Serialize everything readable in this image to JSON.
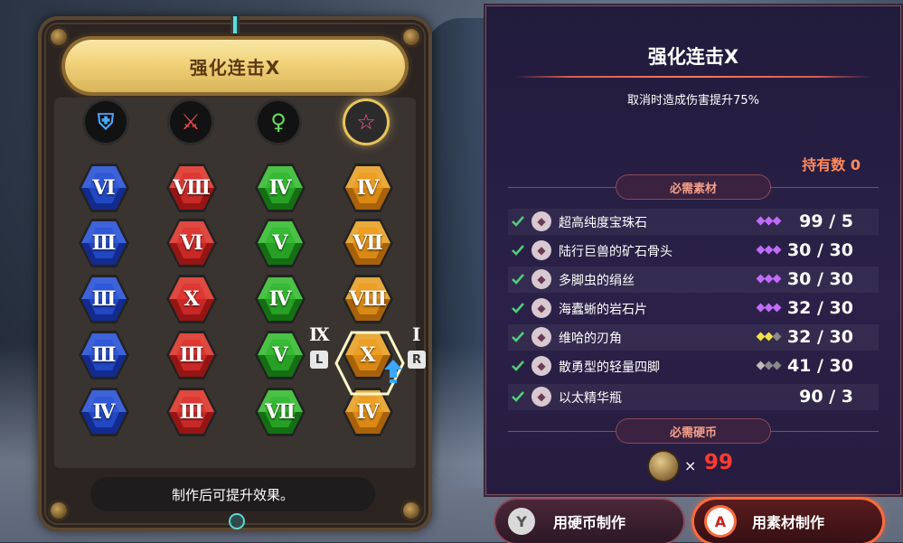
{
  "left_panel": {
    "title": "强化连击X",
    "hint": "制作后可提升效果。",
    "categories": [
      {
        "icon": "shield-icon",
        "glyph": "⛨",
        "color": "#4aa8ff"
      },
      {
        "icon": "sword-icon",
        "glyph": "⚔",
        "color": "#ff4a55"
      },
      {
        "icon": "vitality-icon",
        "glyph": "♀",
        "color": "#62e25a"
      },
      {
        "icon": "star-icon",
        "glyph": "☆",
        "color": "#ff5a8a"
      }
    ],
    "gem_grid": [
      [
        "Ⅵ",
        "Ⅷ",
        "Ⅳ",
        "Ⅳ"
      ],
      [
        "Ⅲ",
        "Ⅵ",
        "Ⅴ",
        "Ⅶ"
      ],
      [
        "Ⅲ",
        "Ⅹ",
        "Ⅳ",
        "Ⅷ"
      ],
      [
        "Ⅲ",
        "Ⅲ",
        "Ⅴ",
        "Ⅹ"
      ],
      [
        "Ⅳ",
        "Ⅲ",
        "Ⅶ",
        "Ⅳ"
      ]
    ],
    "gem_colors": [
      "#2a54d8",
      "#e0322e",
      "#2fb52d",
      "#f09a1a"
    ],
    "prev_level": "Ⅸ",
    "next_level": "Ⅰ",
    "prev_key": "L",
    "next_key": "R"
  },
  "detail": {
    "title": "强化连击X",
    "description": "取消时造成伤害提升75%",
    "owned_label": "持有数",
    "owned_value": "0",
    "materials_header": "必需素材",
    "materials": [
      {
        "name": "超高纯度宝珠石",
        "count": "99 / 5",
        "rarity": [
          "#c26bff",
          "#c26bff",
          "#c26bff"
        ],
        "icon": "orb-icon"
      },
      {
        "name": "陆行巨兽的矿石骨头",
        "count": "30 / 30",
        "rarity": [
          "#c26bff",
          "#c26bff",
          "#c26bff"
        ],
        "icon": "bone-icon"
      },
      {
        "name": "多脚虫的绢丝",
        "count": "30 / 30",
        "rarity": [
          "#c26bff",
          "#c26bff",
          "#c26bff"
        ],
        "icon": "silk-icon"
      },
      {
        "name": "海蠹蜥的岩石片",
        "count": "32 / 30",
        "rarity": [
          "#c26bff",
          "#c26bff",
          "#c26bff"
        ],
        "icon": "rock-shard-icon"
      },
      {
        "name": "维哈的刃角",
        "count": "32 / 30",
        "rarity": [
          "#f2e04a",
          "#f2e04a",
          "#8a8a8a"
        ],
        "icon": "horn-icon"
      },
      {
        "name": "散勇型的轻量四脚",
        "count": "41 / 30",
        "rarity": [
          "#bdbdbd",
          "#8a8a8a",
          "#8a8a8a"
        ],
        "icon": "leg-part-icon"
      },
      {
        "name": "以太精华瓶",
        "count": "90 / 3",
        "rarity": [],
        "icon": "potion-icon"
      }
    ],
    "coins_header": "必需硬币",
    "coin_multiplier": "×",
    "coin_value": "99"
  },
  "actions": {
    "coin_craft": {
      "key": "Y",
      "label": "用硬币制作"
    },
    "material_craft": {
      "key": "A",
      "label": "用素材制作"
    }
  }
}
